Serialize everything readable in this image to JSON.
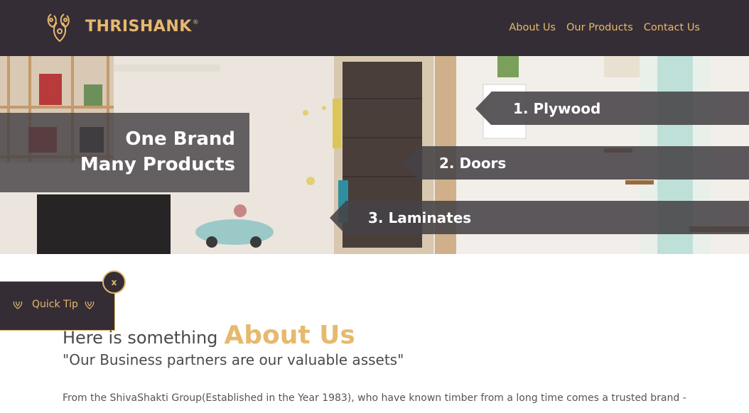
{
  "header": {
    "brand": "THRISHANK",
    "brand_reg": "®",
    "nav": [
      "About Us",
      "Our Products",
      "Contact Us"
    ]
  },
  "hero": {
    "brand_line_1": "One Brand",
    "brand_line_2": "Many Products",
    "products": [
      "1. Plywood",
      "2. Doors",
      "3. Laminates"
    ]
  },
  "quick_tip": {
    "label": "Quick Tip",
    "close": "x"
  },
  "about": {
    "heading_prefix": "Here is something",
    "heading_accent": "About Us",
    "quote": "\"Our Business partners are our valuable assets\"",
    "body": "From the ShivaShakti Group(Established in the Year 1983), who have known timber from a long time comes a trusted brand -"
  },
  "colors": {
    "header_bg": "#352d35",
    "accent": "#e6b96d",
    "ribbon_bg": "#464246"
  }
}
